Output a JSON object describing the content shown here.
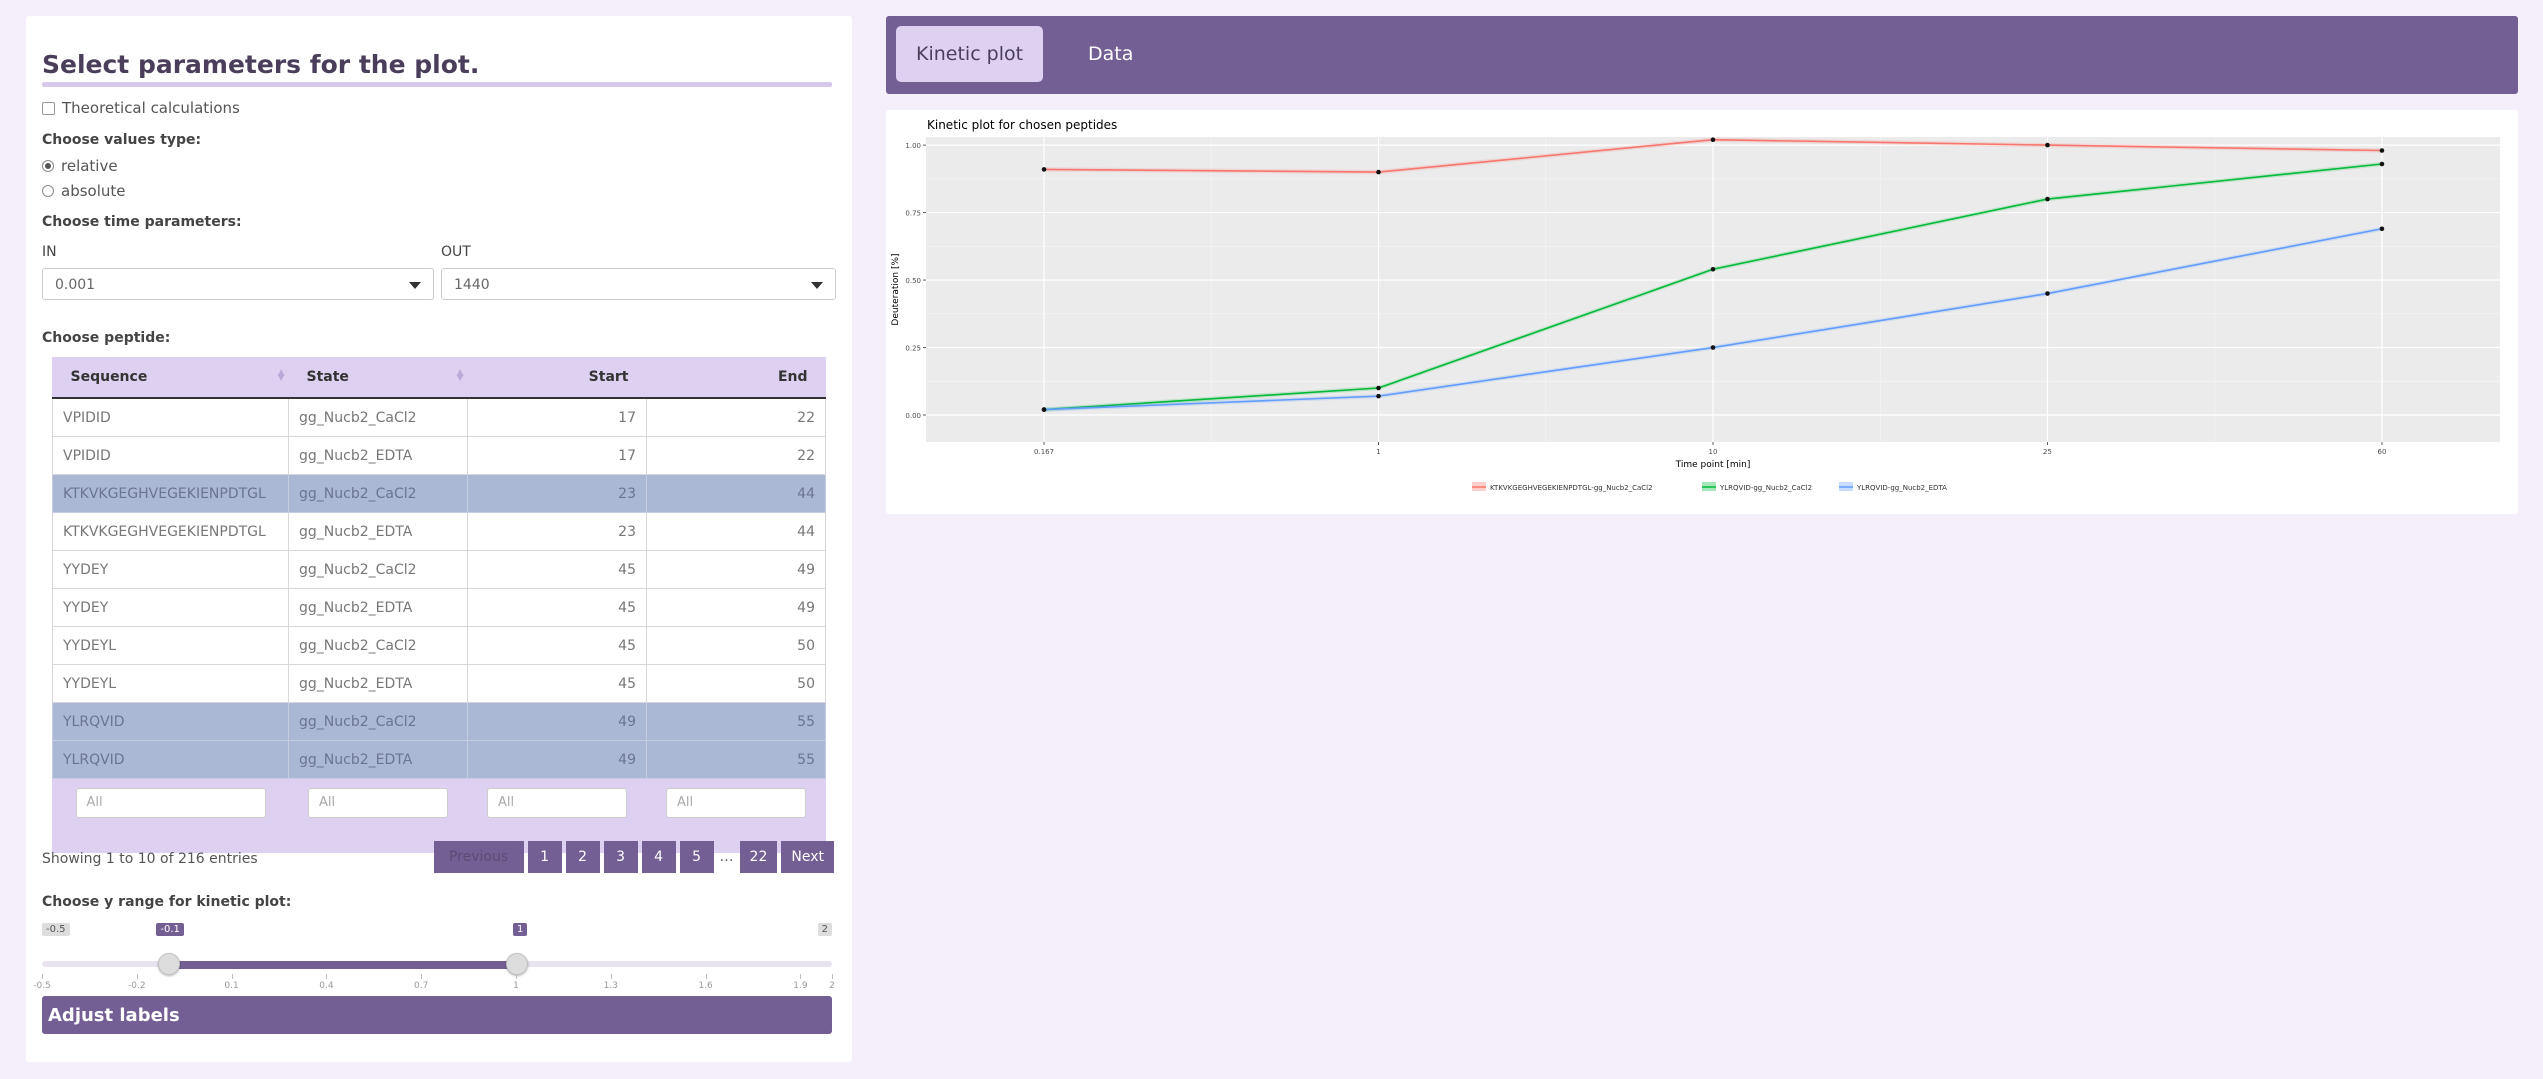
{
  "left_panel": {
    "title": "Select parameters for the plot.",
    "theoretical_label": "Theoretical calculations",
    "values_type_label": "Choose values type:",
    "values_type_options": [
      "relative",
      "absolute"
    ],
    "values_type_selected": "relative",
    "time_params_label": "Choose time parameters:",
    "in_label": "IN",
    "in_value": "0.001",
    "out_label": "OUT",
    "out_value": "1440",
    "peptide_label": "Choose peptide:"
  },
  "table": {
    "columns": [
      "Sequence",
      "State",
      "Start",
      "End"
    ],
    "rows": [
      {
        "sequence": "VPIDID",
        "state": "gg_Nucb2_CaCl2",
        "start": "17",
        "end": "22",
        "selected": false
      },
      {
        "sequence": "VPIDID",
        "state": "gg_Nucb2_EDTA",
        "start": "17",
        "end": "22",
        "selected": false
      },
      {
        "sequence": "KTKVKGEGHVEGEKIENPDTGL",
        "state": "gg_Nucb2_CaCl2",
        "start": "23",
        "end": "44",
        "selected": true
      },
      {
        "sequence": "KTKVKGEGHVEGEKIENPDTGL",
        "state": "gg_Nucb2_EDTA",
        "start": "23",
        "end": "44",
        "selected": false
      },
      {
        "sequence": "YYDEY",
        "state": "gg_Nucb2_CaCl2",
        "start": "45",
        "end": "49",
        "selected": false
      },
      {
        "sequence": "YYDEY",
        "state": "gg_Nucb2_EDTA",
        "start": "45",
        "end": "49",
        "selected": false
      },
      {
        "sequence": "YYDEYL",
        "state": "gg_Nucb2_CaCl2",
        "start": "45",
        "end": "50",
        "selected": false
      },
      {
        "sequence": "YYDEYL",
        "state": "gg_Nucb2_EDTA",
        "start": "45",
        "end": "50",
        "selected": false
      },
      {
        "sequence": "YLRQVID",
        "state": "gg_Nucb2_CaCl2",
        "start": "49",
        "end": "55",
        "selected": true
      },
      {
        "sequence": "YLRQVID",
        "state": "gg_Nucb2_EDTA",
        "start": "49",
        "end": "55",
        "selected": true
      }
    ],
    "filter_placeholder": "All",
    "info": "Showing 1 to 10 of 216 entries",
    "pager": {
      "previous": "Previous",
      "pages": [
        "1",
        "2",
        "3",
        "4",
        "5"
      ],
      "ellipsis": "…",
      "last": "22",
      "next": "Next"
    }
  },
  "slider": {
    "label": "Choose y range for kinetic plot:",
    "min_label": "-0.5",
    "max_label": "2",
    "from_label": "-0.1",
    "to_label": "1",
    "min": -0.5,
    "max": 2,
    "from": -0.1,
    "to": 1,
    "ticks": [
      "-0.5",
      "-0.2",
      "0.1",
      "0.4",
      "0.7",
      "1",
      "1.3",
      "1.6",
      "1.9",
      "2"
    ]
  },
  "adjust_labels": "Adjust labels",
  "tabs": [
    "Kinetic plot",
    "Data"
  ],
  "chart_data": {
    "type": "line",
    "title": "Kinetic plot for chosen peptides",
    "xlabel": "Time point [min]",
    "ylabel": "Deuteration [%]",
    "categories": [
      "0.167",
      "1",
      "10",
      "25",
      "60"
    ],
    "yticks": [
      "0.00",
      "0.25",
      "0.50",
      "0.75",
      "1.00"
    ],
    "ylim": [
      -0.1,
      1.03
    ],
    "grid": true,
    "legend_position": "bottom",
    "series": [
      {
        "name": "KTKVKGEGHVEGEKIENPDTGL-gg_Nucb2_CaCl2",
        "color": "#f8766d",
        "values": [
          0.91,
          0.9,
          1.02,
          1.0,
          0.98
        ]
      },
      {
        "name": "YLRQVID-gg_Nucb2_CaCl2",
        "color": "#00ba38",
        "values": [
          0.02,
          0.1,
          0.54,
          0.8,
          0.93
        ]
      },
      {
        "name": "YLRQVID-gg_Nucb2_EDTA",
        "color": "#619cff",
        "values": [
          0.02,
          0.07,
          0.25,
          0.45,
          0.69
        ]
      }
    ]
  }
}
